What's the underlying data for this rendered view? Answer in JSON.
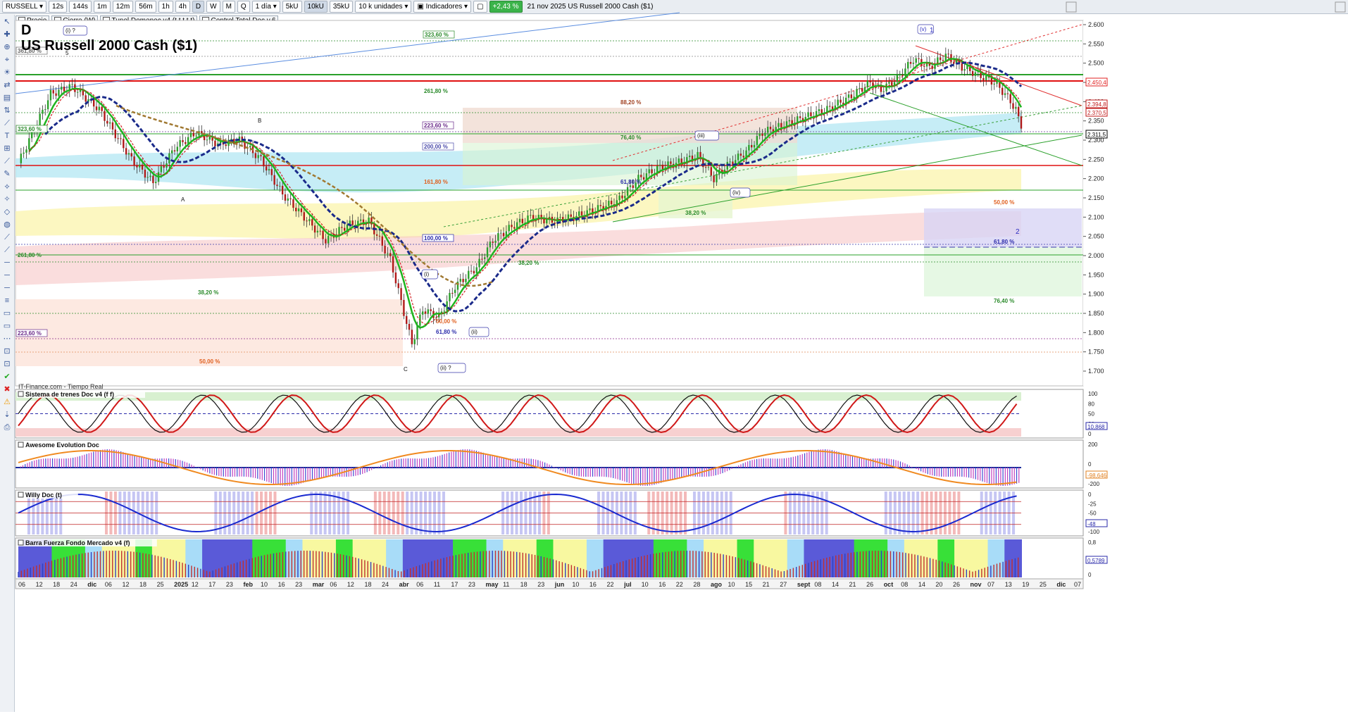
{
  "toolbar": {
    "symbol": "RUSSELL",
    "timeframes": [
      "12s",
      "144s",
      "1m",
      "12m",
      "56m",
      "1h",
      "4h",
      "D",
      "W",
      "M",
      "Q"
    ],
    "active_timeframe": "D",
    "period": "1 día",
    "size_buttons": [
      "5kU",
      "10kU",
      "35kU"
    ],
    "active_size": "10kU",
    "units": "10 k unidades",
    "indicators_label": "Indicadores",
    "change_badge": "+2,43 %",
    "datetime_title": "21 nov 2025  US Russell 2000 Cash ($1)"
  },
  "toolbar2": {
    "items": [
      "Precio",
      "Cierre (W)",
      "Tunel Domenec v4 (t t t t t)",
      "Control Total Doc v.6"
    ]
  },
  "chart": {
    "title_letter": "D",
    "title": "US Russell 2000 Cash ($1)",
    "source": "IT-Finance.com - Tiempo Real",
    "price_axis": [
      "2.600",
      "2.550",
      "2.500",
      "2.450",
      "2.400",
      "2.350",
      "2.300",
      "2.250",
      "2.200",
      "2.150",
      "2.100",
      "2.050",
      "2.000",
      "1.950",
      "1.900",
      "1.850",
      "1.800",
      "1.750",
      "1.700"
    ],
    "price_tags": [
      {
        "text": "2.450,4",
        "color": "#e02020"
      },
      {
        "text": "2.394,8",
        "color": "#c01818"
      },
      {
        "text": "2.370,5",
        "color": "#c01818"
      },
      {
        "text": "2.311,5",
        "color": "#000000"
      }
    ],
    "date_axis": [
      "06",
      "12",
      "18",
      "24",
      "dic",
      "06",
      "12",
      "18",
      "25",
      "2025",
      "12",
      "17",
      "23",
      "feb",
      "10",
      "16",
      "23",
      "mar",
      "06",
      "12",
      "18",
      "24",
      "abr",
      "06",
      "11",
      "17",
      "23",
      "may",
      "11",
      "18",
      "23",
      "jun",
      "10",
      "16",
      "22",
      "jul",
      "10",
      "16",
      "22",
      "28",
      "ago",
      "10",
      "15",
      "21",
      "27",
      "sept",
      "08",
      "14",
      "21",
      "26",
      "oct",
      "08",
      "14",
      "20",
      "26",
      "nov",
      "07",
      "13",
      "19",
      "25",
      "dic",
      "07"
    ],
    "fib_labels": [
      "323,60 %",
      "261,80 %",
      "223,60 %",
      "200,00 %",
      "161,80 %",
      "100,00 %",
      "88,20 %",
      "76,40 %",
      "61,80 %",
      "38,20 %",
      "50,00 %",
      "61,80 %",
      "76,40 %",
      "50,00 %",
      "38,20 %",
      "61,80 %",
      "38,20 %",
      "50,00 %",
      "323,60 %",
      "261,80 %",
      "223,60 %",
      "361,80 %"
    ],
    "wave_labels": [
      "(i) ?",
      "5",
      "A",
      "B",
      "C",
      "(i)",
      "(ii)",
      "(ii) ?",
      "(iii)",
      "(iv)",
      "(v)",
      "1",
      "2"
    ]
  },
  "panels": [
    {
      "title": "Sistema de trenes Doc v4 (f f)",
      "axis": [
        "100",
        "80",
        "50",
        "20",
        "0"
      ],
      "value": "10,868"
    },
    {
      "title": "Awesome Evolution Doc",
      "axis": [
        "200",
        "0",
        "-200"
      ],
      "value": "-98,646"
    },
    {
      "title": "Willy Doc (t)",
      "axis": [
        "0",
        "-25",
        "-50",
        "-75",
        "-100"
      ],
      "value": "-48"
    },
    {
      "title": "Barra Fuerza Fondo Mercado v4 (f)",
      "axis": [
        "0,8",
        "0"
      ],
      "value": "0,5789"
    }
  ]
}
